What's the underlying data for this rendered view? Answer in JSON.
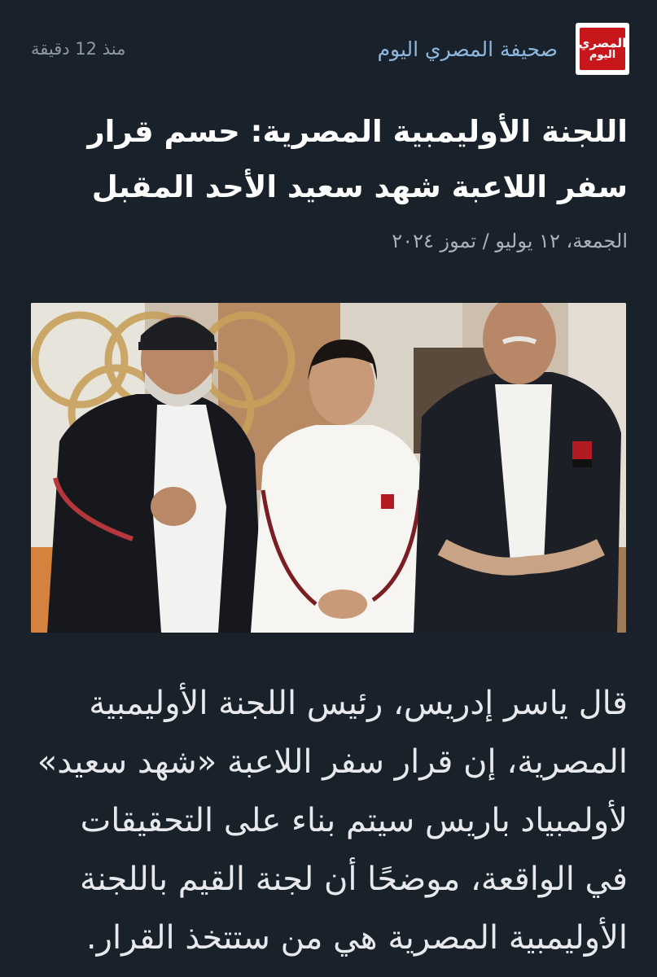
{
  "header": {
    "logo_line1": "المصري",
    "logo_line2": "اليوم",
    "source_name": "صحيفة المصري اليوم",
    "time_ago": "منذ 12 دقيقة"
  },
  "article": {
    "headline": "اللجنة الأوليمبية المصرية: حسم قرار سفر اللاعبة شهد سعيد الأحد المقبل",
    "date": "الجمعة، ١٢ يوليو / تموز ٢٠٢٤",
    "body": "قال ياسر إدريس، رئيس اللجنة الأوليمبية المصرية، إن قرار سفر اللاعبة «شهد سعيد» لأولمبياد باريس سيتم بناء على التحقيقات في الواقعة، موضحًا أن لجنة القيم باللجنة الأوليمبية المصرية هي من ستتخذ القرار."
  },
  "colors": {
    "background": "#19212b",
    "source_link": "#8fb8de",
    "logo_red": "#c8161d"
  }
}
